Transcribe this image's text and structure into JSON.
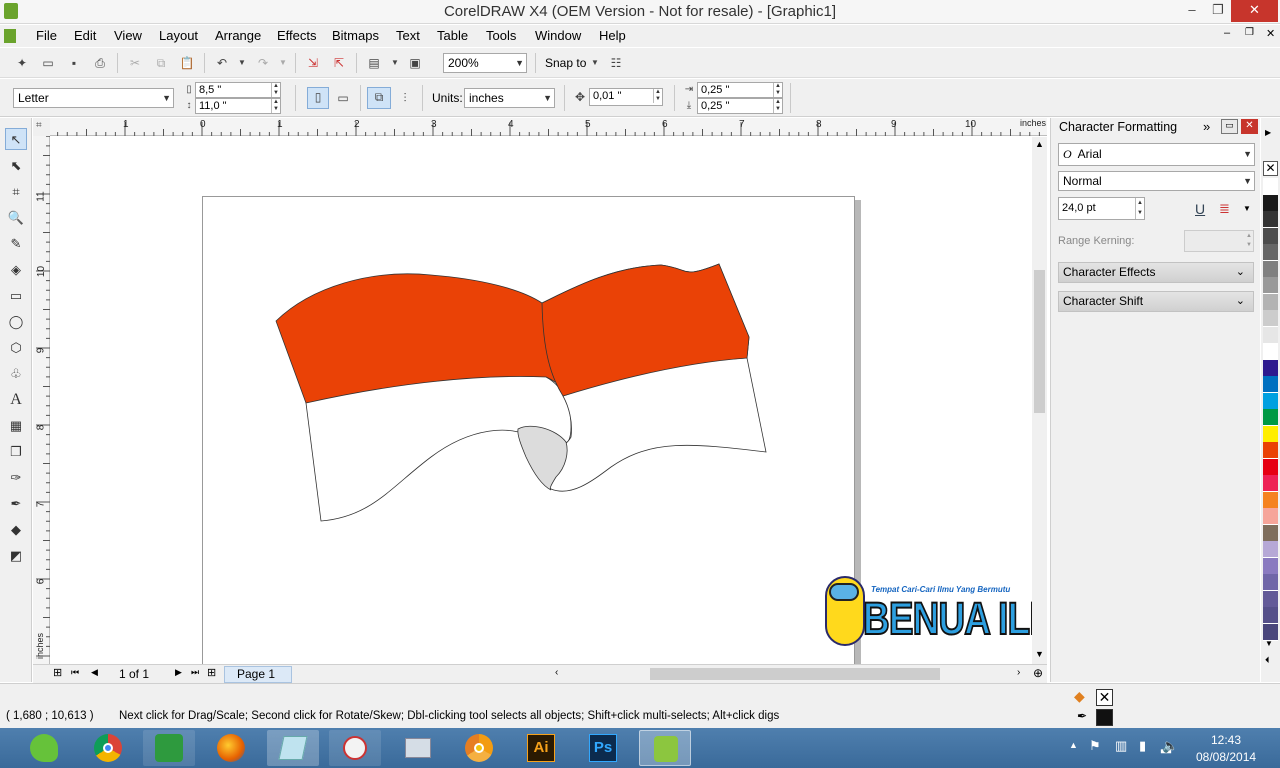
{
  "window": {
    "title": "CorelDRAW X4 (OEM Version - Not for resale) - [Graphic1]",
    "min_glyph": "–",
    "max_glyph": "❐",
    "close_glyph": "✕"
  },
  "menu": [
    "File",
    "Edit",
    "View",
    "Layout",
    "Arrange",
    "Effects",
    "Bitmaps",
    "Text",
    "Table",
    "Tools",
    "Window",
    "Help"
  ],
  "toolbar": {
    "zoom": "200%",
    "snap_to": "Snap to"
  },
  "property_bar": {
    "paper_size": "Letter",
    "width": "8,5 \"",
    "height": "11,0 \"",
    "units_label": "Units:",
    "units_value": "inches",
    "nudge": "0,01 \"",
    "dup_x": "0,25 \"",
    "dup_y": "0,25 \""
  },
  "rulers": {
    "unit": "inches",
    "h_labels": [
      "1",
      "0",
      "1",
      "2",
      "3",
      "4",
      "5",
      "6",
      "7",
      "8",
      "9",
      "10"
    ],
    "v_labels": [
      "11",
      "10",
      "9",
      "8",
      "7",
      "6"
    ]
  },
  "docker": {
    "title": "Character Formatting",
    "font": "Arial",
    "style": "Normal",
    "size": "24,0 pt",
    "range_kerning": "Range Kerning:",
    "effects_label": "Character Effects",
    "shift_label": "Character Shift"
  },
  "page_nav": {
    "counter": "1 of 1",
    "tab": "Page 1"
  },
  "status": {
    "coords": "( 1,680 ; 10,613 )",
    "message": "Next click for Drag/Scale; Second click for Rotate/Skew; Dbl-clicking tool selects all objects; Shift+click multi-selects; Alt+click digs"
  },
  "watermark": {
    "tagline": "Tempat Cari-Cari Ilmu Yang Bermutu",
    "brand": "BENUA ILMU"
  },
  "taskbar": {
    "time": "12:43",
    "date": "08/08/2014",
    "apps": [
      "clover-icon",
      "chrome-icon",
      "cleaner-icon",
      "firefox-icon",
      "notepad-icon",
      "paint-icon",
      "screenshot-icon",
      "chrome-canary-icon",
      "illustrator-icon",
      "photoshop-icon",
      "corel-icon"
    ],
    "ai_label": "Ai",
    "ps_label": "Ps"
  },
  "colors": {
    "flag_red": "#ea4206",
    "flag_white": "#ffffff",
    "flag_fold": "#dcdcdc",
    "taskbar": "#3f6f9f"
  },
  "palette": [
    "#ffffff",
    "#1a1a1a",
    "#333333",
    "#4d4d4d",
    "#666666",
    "#808080",
    "#999999",
    "#b3b3b3",
    "#cccccc",
    "#e6e6e6",
    "#ffffff",
    "#2e1a8f",
    "#0070c0",
    "#00a0e0",
    "#009944",
    "#ffee00",
    "#ea4206",
    "#e60012",
    "#ee2255",
    "#f58220",
    "#f6a59a",
    "#7f6e5d",
    "#b6a8d6",
    "#8a7ac0",
    "#7066a8",
    "#635a98",
    "#56508a",
    "#4a467c"
  ]
}
